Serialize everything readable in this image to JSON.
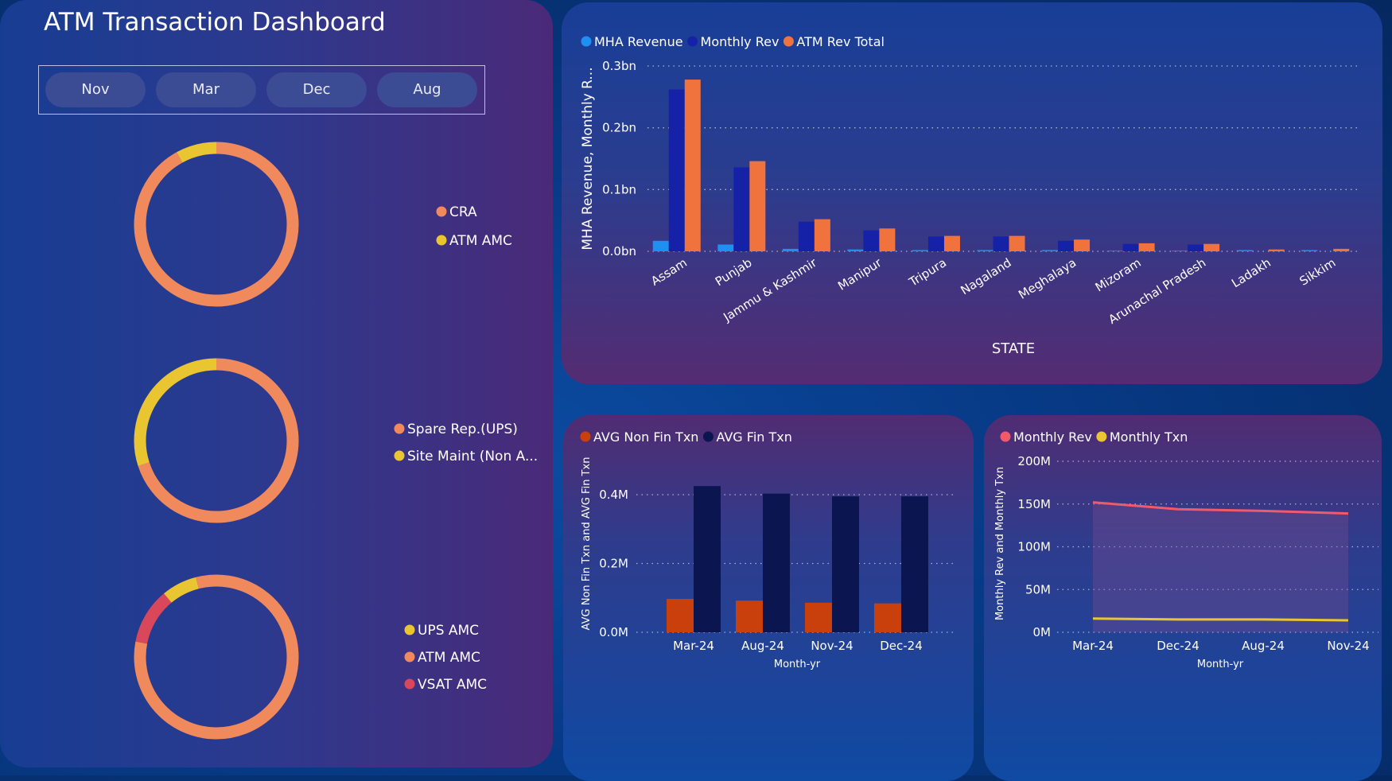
{
  "dashboard": {
    "title": "ATM Transaction Dashboard",
    "slicer": [
      "Nov",
      "Mar",
      "Dec",
      "Aug"
    ]
  },
  "chart_data": [
    {
      "type": "pie",
      "variant": "donut",
      "labels": [
        "CRA",
        "ATM AMC"
      ],
      "values": [
        92,
        8
      ],
      "colors": [
        "#f08a5d",
        "#e8c531"
      ],
      "legend": "right"
    },
    {
      "type": "pie",
      "variant": "donut",
      "labels": [
        "Spare Rep.(UPS)",
        "Site Maint (Non A..."
      ],
      "values": [
        70,
        30
      ],
      "colors": [
        "#f08a5d",
        "#e8c531"
      ],
      "legend": "right"
    },
    {
      "type": "pie",
      "variant": "donut",
      "labels": [
        "UPS AMC",
        "ATM AMC",
        "VSAT AMC"
      ],
      "values": [
        7,
        82,
        11
      ],
      "colors": [
        "#e8c531",
        "#f08a5d",
        "#d9475b"
      ],
      "legend": "right"
    },
    {
      "type": "bar",
      "categories": [
        "Assam",
        "Punjab",
        "Jammu & Kashmir",
        "Manipur",
        "Tripura",
        "Nagaland",
        "Meghalaya",
        "Mizoram",
        "Arunachal Pradesh",
        "Ladakh",
        "Sikkim"
      ],
      "series": [
        {
          "name": "MHA Revenue",
          "color": "#1f8ff2",
          "values": [
            0.017,
            0.011,
            0.004,
            0.003,
            0.002,
            0.002,
            0.002,
            0.001,
            0.001,
            0.002,
            0.002
          ]
        },
        {
          "name": "Monthly Rev",
          "color": "#1522a8",
          "values": [
            0.262,
            0.136,
            0.048,
            0.034,
            0.024,
            0.024,
            0.017,
            0.012,
            0.011,
            0.0,
            0.0
          ]
        },
        {
          "name": "ATM Rev Total",
          "color": "#f0733e",
          "values": [
            0.278,
            0.146,
            0.052,
            0.037,
            0.025,
            0.025,
            0.019,
            0.013,
            0.012,
            0.003,
            0.004
          ]
        }
      ],
      "ylabel": "MHA Revenue, Monthly R...",
      "xlabel": "STATE",
      "yticks": [
        "0.0bn",
        "0.1bn",
        "0.2bn",
        "0.3bn"
      ],
      "ylim": [
        0,
        0.3
      ],
      "grid": true,
      "legend": "top-left"
    },
    {
      "type": "bar",
      "categories": [
        "Mar-24",
        "Aug-24",
        "Nov-24",
        "Dec-24"
      ],
      "series": [
        {
          "name": "AVG Non Fin Txn",
          "color": "#c9400c",
          "values": [
            0.097,
            0.092,
            0.086,
            0.084
          ]
        },
        {
          "name": "AVG Fin Txn",
          "color": "#0b1550",
          "values": [
            0.425,
            0.403,
            0.395,
            0.395
          ]
        }
      ],
      "ylabel": "AVG Non Fin Txn and AVG Fin Txn",
      "xlabel": "Month-yr",
      "yticks": [
        "0.0M",
        "0.2M",
        "0.4M"
      ],
      "ylim": [
        0,
        0.4
      ],
      "grid": true,
      "legend": "top-left"
    },
    {
      "type": "line",
      "x": [
        "Mar-24",
        "Dec-24",
        "Aug-24",
        "Nov-24"
      ],
      "series": [
        {
          "name": "Monthly Rev",
          "color": "#f05a6a",
          "values": [
            152,
            144,
            142,
            139
          ]
        },
        {
          "name": "Monthly Txn",
          "color": "#e8c531",
          "values": [
            16,
            15,
            15,
            14
          ]
        }
      ],
      "ylabel": "Monthly Rev and Monthly Txn",
      "xlabel": "Month-yr",
      "yticks": [
        "0M",
        "50M",
        "100M",
        "150M",
        "200M"
      ],
      "ylim": [
        0,
        200
      ],
      "grid": true,
      "legend": "top-left"
    }
  ]
}
